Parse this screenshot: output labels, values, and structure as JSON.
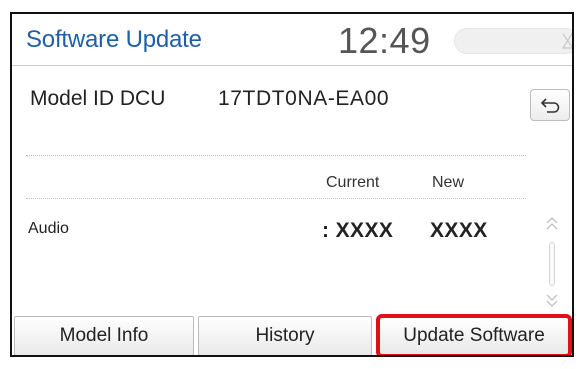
{
  "header": {
    "title": "Software Update",
    "clock": "12:49",
    "accent_color": "#1f5fa8",
    "signal_icon": "no-signal-icon"
  },
  "model": {
    "label": "Model ID DCU",
    "value": "17TDT0NA-EA00",
    "back_icon": "back-arrow-icon"
  },
  "versions": {
    "current_header": "Current",
    "new_header": "New",
    "rows": [
      {
        "name": "Audio",
        "current": ": XXXX",
        "new": "XXXX"
      }
    ]
  },
  "scroll": {
    "up_icon": "chevron-double-up-icon",
    "down_icon": "chevron-double-down-icon"
  },
  "tabs": {
    "model_info": "Model Info",
    "history": "History",
    "update_software": "Update Software",
    "highlight_color": "#e10f1b"
  }
}
